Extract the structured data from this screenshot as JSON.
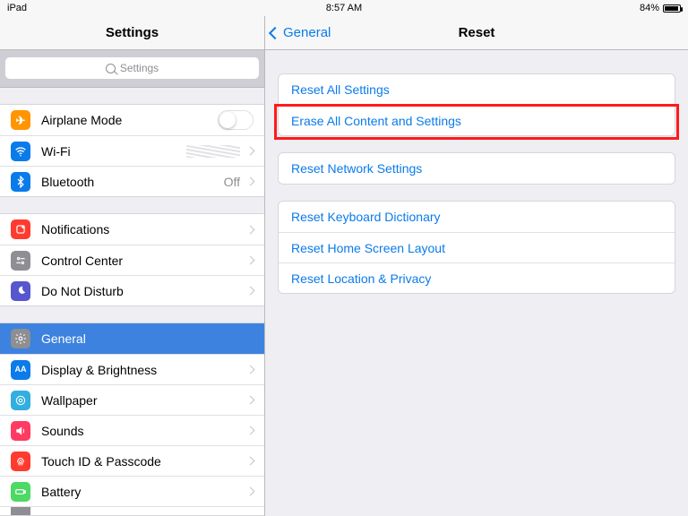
{
  "status": {
    "device": "iPad",
    "time": "8:57 AM",
    "battery_pct": "84%"
  },
  "left": {
    "title": "Settings",
    "search_placeholder": "Settings",
    "g1": {
      "airplane": "Airplane Mode",
      "wifi": "Wi-Fi",
      "bluetooth": "Bluetooth",
      "bluetooth_value": "Off"
    },
    "g2": {
      "notifications": "Notifications",
      "control_center": "Control Center",
      "dnd": "Do Not Disturb"
    },
    "g3": {
      "general": "General",
      "display": "Display & Brightness",
      "wallpaper": "Wallpaper",
      "sounds": "Sounds",
      "touchid": "Touch ID & Passcode",
      "battery": "Battery"
    }
  },
  "right": {
    "back_label": "General",
    "title": "Reset",
    "g1": {
      "reset_all": "Reset All Settings",
      "erase_all": "Erase All Content and Settings"
    },
    "g2": {
      "reset_network": "Reset Network Settings"
    },
    "g3": {
      "reset_keyboard": "Reset Keyboard Dictionary",
      "reset_home": "Reset Home Screen Layout",
      "reset_location": "Reset Location & Privacy"
    }
  }
}
